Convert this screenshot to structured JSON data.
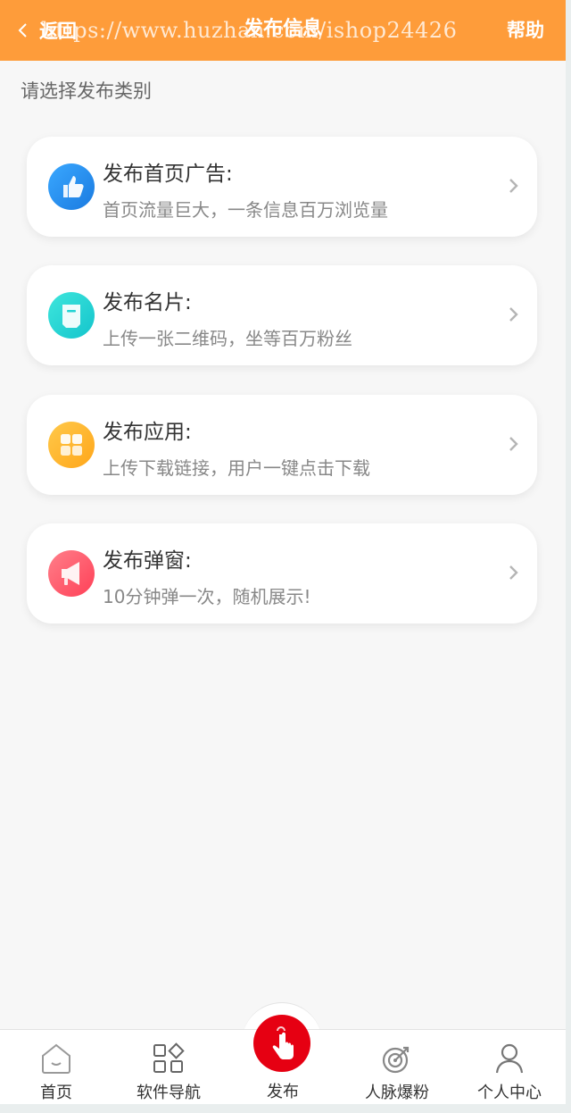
{
  "header": {
    "back_label": "返回",
    "title": "发布信息",
    "help_label": "帮助",
    "watermark": "https://www.huzhan.com/ishop24426",
    "background": "#fe9c3a"
  },
  "section_label": "请选择发布类别",
  "cards": [
    {
      "title": "发布首页广告:",
      "desc": "首页流量巨大，一条信息百万浏览量",
      "icon": "thumbs-up-icon",
      "color": "#2e8ff0"
    },
    {
      "title": "发布名片:",
      "desc": "上传一张二维码，坐等百万粉丝",
      "icon": "card-icon",
      "color": "#22d3d3"
    },
    {
      "title": "发布应用:",
      "desc": "上传下载链接，用户一键点击下载",
      "icon": "apps-grid-icon",
      "color": "#ffb629"
    },
    {
      "title": "发布弹窗:",
      "desc": "10分钟弹一次，随机展示!",
      "icon": "megaphone-icon",
      "color": "#ff5e6e"
    }
  ],
  "tabbar": {
    "home": "首页",
    "nav": "软件导航",
    "publish": "发布",
    "fans": "人脉爆粉",
    "me": "个人中心",
    "publish_color": "#e60012"
  }
}
